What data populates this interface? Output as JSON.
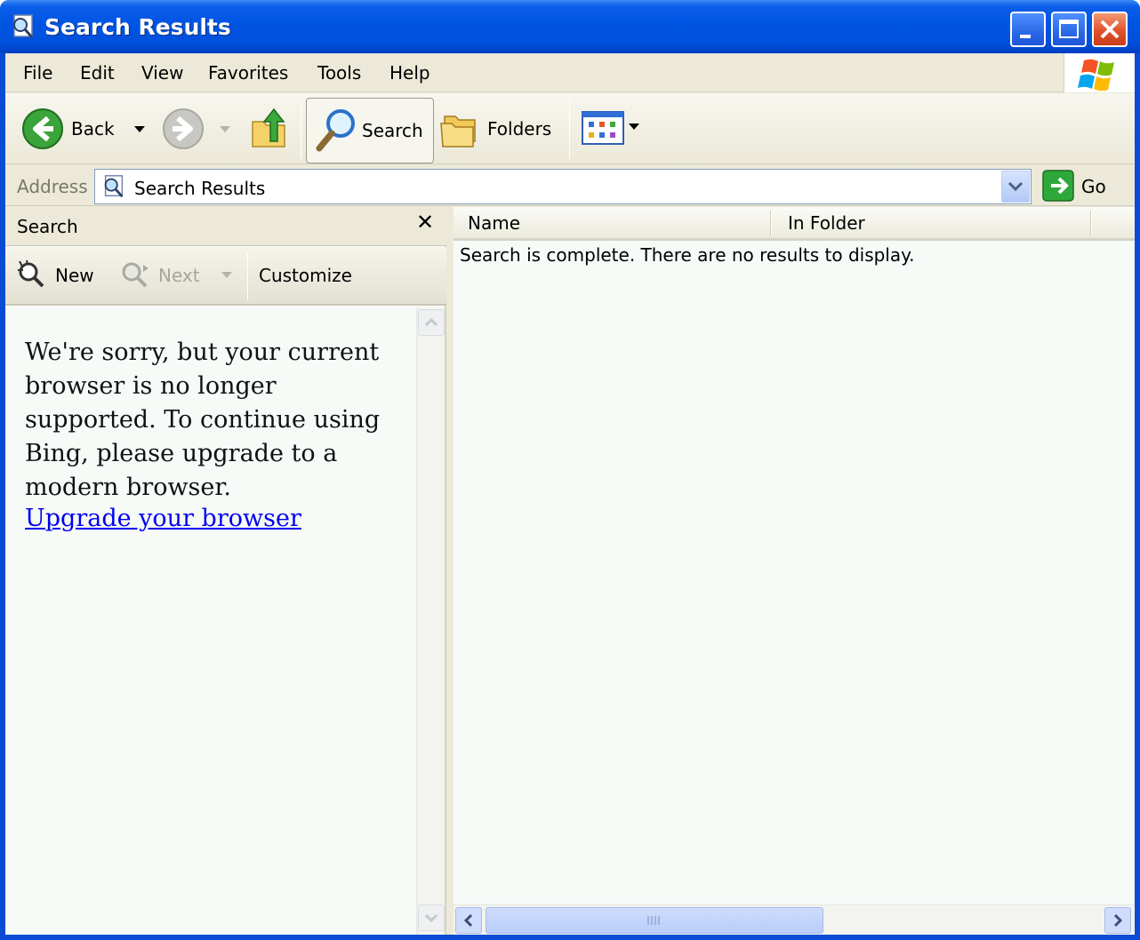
{
  "window": {
    "title": "Search Results",
    "icon": "search-results-icon",
    "controls": [
      "minimize-icon",
      "maximize-icon",
      "close-icon"
    ]
  },
  "menu": {
    "items": [
      "File",
      "Edit",
      "View",
      "Favorites",
      "Tools",
      "Help"
    ]
  },
  "toolbar": {
    "back_label": "Back",
    "search_label": "Search",
    "folders_label": "Folders"
  },
  "address": {
    "label": "Address",
    "value": "Search Results",
    "go_label": "Go"
  },
  "search_pane": {
    "title": "Search",
    "close_glyph": "✕",
    "new_label": "New",
    "next_label": "Next",
    "customize_label": "Customize",
    "message": "We're sorry, but your current browser is no longer supported. To continue using Bing, please upgrade to a modern browser.",
    "link": "Upgrade your browser"
  },
  "results": {
    "columns": [
      "Name",
      "In Folder"
    ],
    "message": "Search is complete. There are no results to display."
  },
  "colors": {
    "titlebar": "#0054e3",
    "chrome": "#ece9d8",
    "pane_bg": "#f6fbf8",
    "link": "#0000ee"
  }
}
